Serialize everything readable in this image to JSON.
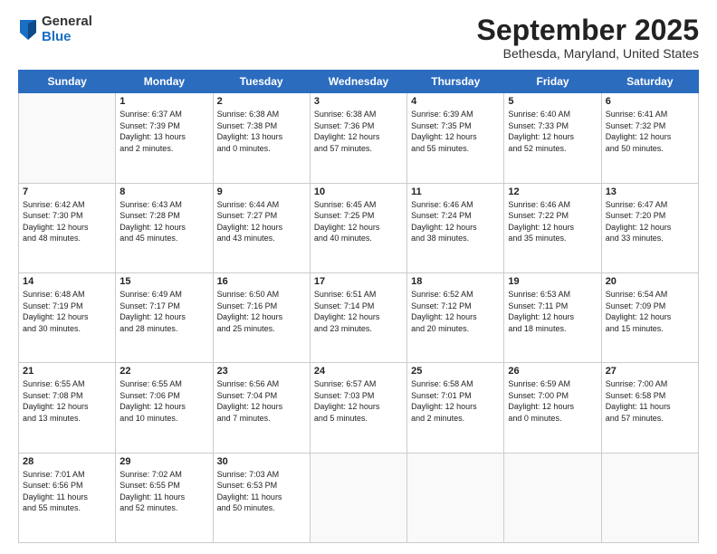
{
  "logo": {
    "general": "General",
    "blue": "Blue"
  },
  "header": {
    "month": "September 2025",
    "location": "Bethesda, Maryland, United States"
  },
  "days": [
    "Sunday",
    "Monday",
    "Tuesday",
    "Wednesday",
    "Thursday",
    "Friday",
    "Saturday"
  ],
  "weeks": [
    [
      {
        "day": "",
        "info": ""
      },
      {
        "day": "1",
        "info": "Sunrise: 6:37 AM\nSunset: 7:39 PM\nDaylight: 13 hours\nand 2 minutes."
      },
      {
        "day": "2",
        "info": "Sunrise: 6:38 AM\nSunset: 7:38 PM\nDaylight: 13 hours\nand 0 minutes."
      },
      {
        "day": "3",
        "info": "Sunrise: 6:38 AM\nSunset: 7:36 PM\nDaylight: 12 hours\nand 57 minutes."
      },
      {
        "day": "4",
        "info": "Sunrise: 6:39 AM\nSunset: 7:35 PM\nDaylight: 12 hours\nand 55 minutes."
      },
      {
        "day": "5",
        "info": "Sunrise: 6:40 AM\nSunset: 7:33 PM\nDaylight: 12 hours\nand 52 minutes."
      },
      {
        "day": "6",
        "info": "Sunrise: 6:41 AM\nSunset: 7:32 PM\nDaylight: 12 hours\nand 50 minutes."
      }
    ],
    [
      {
        "day": "7",
        "info": "Sunrise: 6:42 AM\nSunset: 7:30 PM\nDaylight: 12 hours\nand 48 minutes."
      },
      {
        "day": "8",
        "info": "Sunrise: 6:43 AM\nSunset: 7:28 PM\nDaylight: 12 hours\nand 45 minutes."
      },
      {
        "day": "9",
        "info": "Sunrise: 6:44 AM\nSunset: 7:27 PM\nDaylight: 12 hours\nand 43 minutes."
      },
      {
        "day": "10",
        "info": "Sunrise: 6:45 AM\nSunset: 7:25 PM\nDaylight: 12 hours\nand 40 minutes."
      },
      {
        "day": "11",
        "info": "Sunrise: 6:46 AM\nSunset: 7:24 PM\nDaylight: 12 hours\nand 38 minutes."
      },
      {
        "day": "12",
        "info": "Sunrise: 6:46 AM\nSunset: 7:22 PM\nDaylight: 12 hours\nand 35 minutes."
      },
      {
        "day": "13",
        "info": "Sunrise: 6:47 AM\nSunset: 7:20 PM\nDaylight: 12 hours\nand 33 minutes."
      }
    ],
    [
      {
        "day": "14",
        "info": "Sunrise: 6:48 AM\nSunset: 7:19 PM\nDaylight: 12 hours\nand 30 minutes."
      },
      {
        "day": "15",
        "info": "Sunrise: 6:49 AM\nSunset: 7:17 PM\nDaylight: 12 hours\nand 28 minutes."
      },
      {
        "day": "16",
        "info": "Sunrise: 6:50 AM\nSunset: 7:16 PM\nDaylight: 12 hours\nand 25 minutes."
      },
      {
        "day": "17",
        "info": "Sunrise: 6:51 AM\nSunset: 7:14 PM\nDaylight: 12 hours\nand 23 minutes."
      },
      {
        "day": "18",
        "info": "Sunrise: 6:52 AM\nSunset: 7:12 PM\nDaylight: 12 hours\nand 20 minutes."
      },
      {
        "day": "19",
        "info": "Sunrise: 6:53 AM\nSunset: 7:11 PM\nDaylight: 12 hours\nand 18 minutes."
      },
      {
        "day": "20",
        "info": "Sunrise: 6:54 AM\nSunset: 7:09 PM\nDaylight: 12 hours\nand 15 minutes."
      }
    ],
    [
      {
        "day": "21",
        "info": "Sunrise: 6:55 AM\nSunset: 7:08 PM\nDaylight: 12 hours\nand 13 minutes."
      },
      {
        "day": "22",
        "info": "Sunrise: 6:55 AM\nSunset: 7:06 PM\nDaylight: 12 hours\nand 10 minutes."
      },
      {
        "day": "23",
        "info": "Sunrise: 6:56 AM\nSunset: 7:04 PM\nDaylight: 12 hours\nand 7 minutes."
      },
      {
        "day": "24",
        "info": "Sunrise: 6:57 AM\nSunset: 7:03 PM\nDaylight: 12 hours\nand 5 minutes."
      },
      {
        "day": "25",
        "info": "Sunrise: 6:58 AM\nSunset: 7:01 PM\nDaylight: 12 hours\nand 2 minutes."
      },
      {
        "day": "26",
        "info": "Sunrise: 6:59 AM\nSunset: 7:00 PM\nDaylight: 12 hours\nand 0 minutes."
      },
      {
        "day": "27",
        "info": "Sunrise: 7:00 AM\nSunset: 6:58 PM\nDaylight: 11 hours\nand 57 minutes."
      }
    ],
    [
      {
        "day": "28",
        "info": "Sunrise: 7:01 AM\nSunset: 6:56 PM\nDaylight: 11 hours\nand 55 minutes."
      },
      {
        "day": "29",
        "info": "Sunrise: 7:02 AM\nSunset: 6:55 PM\nDaylight: 11 hours\nand 52 minutes."
      },
      {
        "day": "30",
        "info": "Sunrise: 7:03 AM\nSunset: 6:53 PM\nDaylight: 11 hours\nand 50 minutes."
      },
      {
        "day": "",
        "info": ""
      },
      {
        "day": "",
        "info": ""
      },
      {
        "day": "",
        "info": ""
      },
      {
        "day": "",
        "info": ""
      }
    ]
  ]
}
